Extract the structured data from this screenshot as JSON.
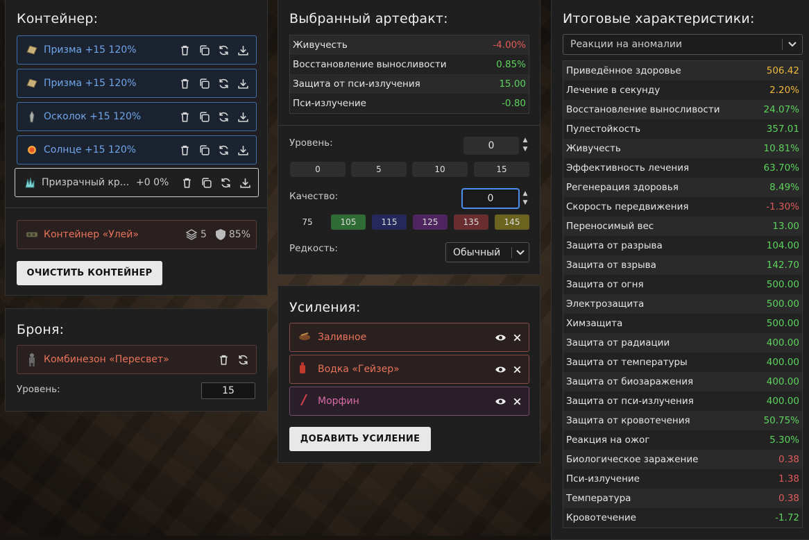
{
  "container": {
    "title": "Контейнер:",
    "items": [
      {
        "label": "Призма +15 120%"
      },
      {
        "label": "Призма +15 120%"
      },
      {
        "label": "Осколок +15 120%"
      },
      {
        "label": "Солнце +15 120%"
      },
      {
        "label": "Призрачный кр...",
        "suffix": "+0 0%"
      }
    ],
    "container_name": "Контейнер «Улей»",
    "slots": "5",
    "protection": "85%",
    "clear_label": "ОЧИСТИТЬ КОНТЕЙНЕР"
  },
  "armor": {
    "title": "Броня:",
    "name": "Комбинезон «Пересвет»",
    "level_label": "Уровень:",
    "level_value": "15"
  },
  "artifact": {
    "title": "Выбранный артефакт:",
    "stats": [
      {
        "name": "Живучесть",
        "value": "-4.00%",
        "tone": "r"
      },
      {
        "name": "Восстановление выносливости",
        "value": "0.85%",
        "tone": "g"
      },
      {
        "name": "Защита от пси-излучения",
        "value": "15.00",
        "tone": "g"
      },
      {
        "name": "Пси-излучение",
        "value": "-0.80",
        "tone": "g"
      }
    ],
    "level_label": "Уровень:",
    "level_value": "0",
    "level_presets": [
      "0",
      "5",
      "10",
      "15"
    ],
    "quality_label": "Качество:",
    "quality_value": "0",
    "quality_presets": [
      {
        "label": "75",
        "color": "#1e1e1e"
      },
      {
        "label": "105",
        "color": "#2f6b34"
      },
      {
        "label": "115",
        "color": "#25285a"
      },
      {
        "label": "125",
        "color": "#4f2560"
      },
      {
        "label": "135",
        "color": "#6b2e30"
      },
      {
        "label": "145",
        "color": "#6b6420"
      }
    ],
    "rarity_label": "Редкость:",
    "rarity_value": "Обычный"
  },
  "boosts": {
    "title": "Усиления:",
    "items": [
      {
        "label": "Заливное"
      },
      {
        "label": "Водка «Гейзер»"
      },
      {
        "label": "Морфин"
      }
    ],
    "add_label": "ДОБАВИТЬ УСИЛЕНИЕ"
  },
  "totals": {
    "title": "Итоговые характеристики:",
    "filter": "Реакции на аномалии",
    "stats": [
      {
        "name": "Приведённое здоровье",
        "value": "506.42",
        "tone": "y"
      },
      {
        "name": "Лечение в секунду",
        "value": "2.20%",
        "tone": "y"
      },
      {
        "name": "Восстановление выносливости",
        "value": "24.07%",
        "tone": "g"
      },
      {
        "name": "Пулестойкость",
        "value": "357.01",
        "tone": "g"
      },
      {
        "name": "Живучесть",
        "value": "10.81%",
        "tone": "g"
      },
      {
        "name": "Эффективность лечения",
        "value": "63.70%",
        "tone": "g"
      },
      {
        "name": "Регенерация здоровья",
        "value": "8.49%",
        "tone": "g"
      },
      {
        "name": "Скорость передвижения",
        "value": "-1.30%",
        "tone": "r"
      },
      {
        "name": "Переносимый вес",
        "value": "13.00",
        "tone": "g"
      },
      {
        "name": "Защита от разрыва",
        "value": "104.00",
        "tone": "g"
      },
      {
        "name": "Защита от взрыва",
        "value": "142.70",
        "tone": "g"
      },
      {
        "name": "Защита от огня",
        "value": "500.00",
        "tone": "g"
      },
      {
        "name": "Электрозащита",
        "value": "500.00",
        "tone": "g"
      },
      {
        "name": "Химзащита",
        "value": "500.00",
        "tone": "g"
      },
      {
        "name": "Защита от радиации",
        "value": "400.00",
        "tone": "g"
      },
      {
        "name": "Защита от температуры",
        "value": "400.00",
        "tone": "g"
      },
      {
        "name": "Защита от биозаражения",
        "value": "400.00",
        "tone": "g"
      },
      {
        "name": "Защита от пси-излучения",
        "value": "400.00",
        "tone": "g"
      },
      {
        "name": "Защита от кровотечения",
        "value": "50.75%",
        "tone": "g"
      },
      {
        "name": "Реакция на ожог",
        "value": "5.30%",
        "tone": "g"
      },
      {
        "name": "Биологическое заражение",
        "value": "0.38",
        "tone": "r"
      },
      {
        "name": "Пси-излучение",
        "value": "1.38",
        "tone": "r"
      },
      {
        "name": "Температура",
        "value": "0.38",
        "tone": "r"
      },
      {
        "name": "Кровотечение",
        "value": "-1.72",
        "tone": "g"
      }
    ]
  }
}
